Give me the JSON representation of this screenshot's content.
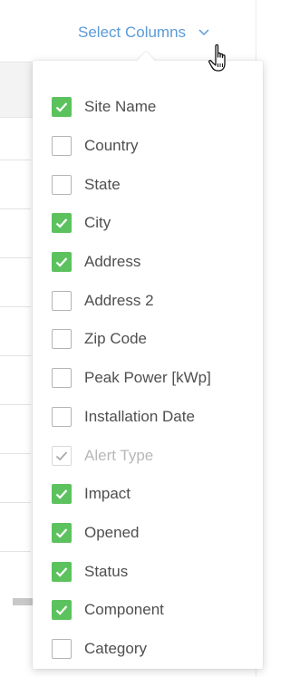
{
  "header": {
    "trigger_label": "Select Columns",
    "chevron_icon": "chevron-down-icon",
    "cursor_icon": "hand-pointer-icon"
  },
  "colors": {
    "link": "#5b9bd9",
    "checked": "#5cc25e",
    "text": "#4f4f4f",
    "disabled_text": "#b8b8b8"
  },
  "columns": [
    {
      "label": "Site Name",
      "checked": true,
      "disabled": false
    },
    {
      "label": "Country",
      "checked": false,
      "disabled": false
    },
    {
      "label": "State",
      "checked": false,
      "disabled": false
    },
    {
      "label": "City",
      "checked": true,
      "disabled": false
    },
    {
      "label": "Address",
      "checked": true,
      "disabled": false
    },
    {
      "label": "Address 2",
      "checked": false,
      "disabled": false
    },
    {
      "label": "Zip Code",
      "checked": false,
      "disabled": false
    },
    {
      "label": "Peak Power [kWp]",
      "checked": false,
      "disabled": false
    },
    {
      "label": "Installation Date",
      "checked": false,
      "disabled": false
    },
    {
      "label": "Alert Type",
      "checked": true,
      "disabled": true
    },
    {
      "label": "Impact",
      "checked": true,
      "disabled": false
    },
    {
      "label": "Opened",
      "checked": true,
      "disabled": false
    },
    {
      "label": "Status",
      "checked": true,
      "disabled": false
    },
    {
      "label": "Component",
      "checked": true,
      "disabled": false
    },
    {
      "label": "Category",
      "checked": false,
      "disabled": false
    }
  ]
}
